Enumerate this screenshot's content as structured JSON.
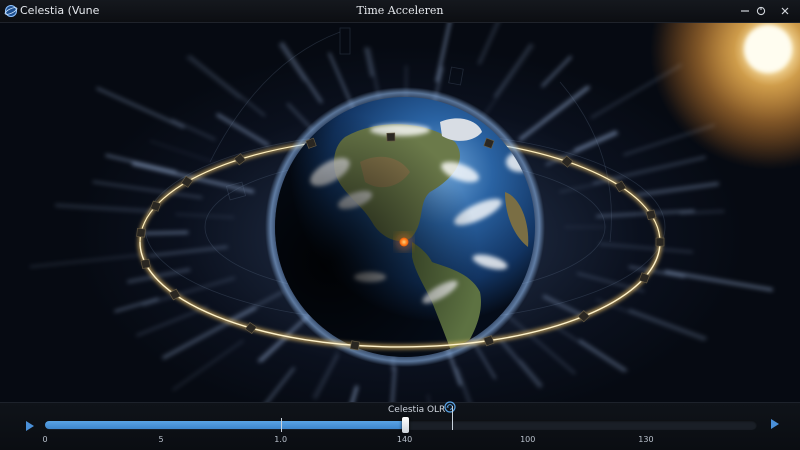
{
  "window": {
    "app_name": "Celestia (Vune",
    "title": "Time Acceleren",
    "controls": [
      "minimize",
      "maximize",
      "close"
    ]
  },
  "scene": {
    "description_icons": [
      "earth-globe",
      "orbit-ring",
      "sun-glow",
      "location-marker"
    ],
    "colors": {
      "orbit_ring": "#f0c46a",
      "marker": "#ff7a1a",
      "ocean": "#1c4f8c",
      "sun": "#fff4c8"
    }
  },
  "timeline": {
    "label": "Celestia OLR",
    "progress": 0.505,
    "markers_fraction": [
      0.331,
      0.572
    ],
    "ticks": [
      {
        "label": "0",
        "fraction": 0.0
      },
      {
        "label": "5",
        "fraction": 0.163
      },
      {
        "label": "1.0",
        "fraction": 0.331
      },
      {
        "label": "140",
        "fraction": 0.505
      },
      {
        "label": "100",
        "fraction": 0.678
      },
      {
        "label": "130",
        "fraction": 0.844
      }
    ],
    "fill_color": "#3d85cc",
    "play_color": "#4a90d9"
  }
}
